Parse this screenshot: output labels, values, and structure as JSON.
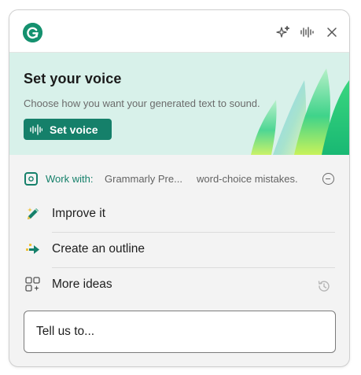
{
  "header": {
    "logo_letter": "G",
    "brand_color": "#15916f"
  },
  "banner": {
    "title": "Set your voice",
    "description": "Choose how you want your generated text to sound.",
    "button_label": "Set voice",
    "background": "#d8f1ea",
    "button_color": "#15806a"
  },
  "work_with": {
    "label": "Work with:",
    "values": [
      "Grammarly Pre...",
      "word-choice mistakes."
    ]
  },
  "actions": [
    {
      "label": "Improve it",
      "icon": "pencil-sparkle-icon"
    },
    {
      "label": "Create an outline",
      "icon": "outline-arrow-icon"
    },
    {
      "label": "More ideas",
      "icon": "grid-ideas-icon"
    }
  ],
  "prompt": {
    "value": "Tell us to..."
  }
}
